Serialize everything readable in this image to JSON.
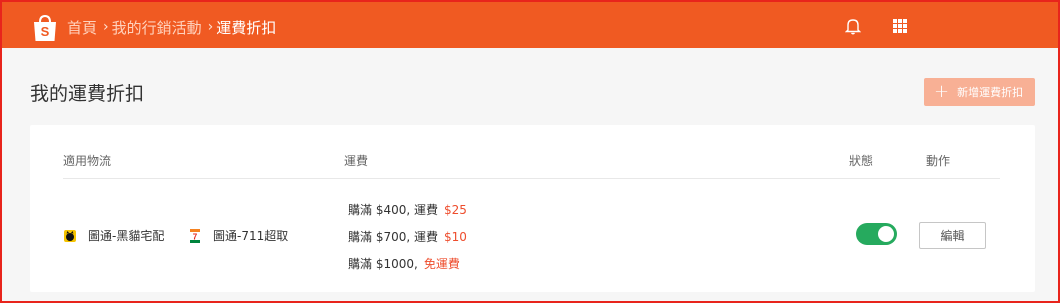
{
  "colors": {
    "brand": "#f05a22",
    "accent_text": "#ee4d2d",
    "toggle_on": "#26aa5e",
    "add_button_bg": "#f8b095",
    "frame_border": "#e8241c"
  },
  "header": {
    "logo_icon": "shopee-bag-icon",
    "breadcrumb": {
      "home": "首頁",
      "marketing": "我的行銷活動",
      "current": "運費折扣"
    },
    "icons": [
      "bell-icon",
      "apps-grid-icon"
    ]
  },
  "page": {
    "title": "我的運費折扣",
    "add_button": {
      "icon": "plus-icon",
      "label": "新增運費折扣"
    }
  },
  "table": {
    "headers": {
      "carriers": "適用物流",
      "fee": "運費",
      "status": "狀態",
      "action": "動作"
    },
    "rows": [
      {
        "carriers": [
          {
            "icon": "black-cat-logo-icon",
            "name": "圖通-黑貓宅配"
          },
          {
            "icon": "seven-eleven-logo-icon",
            "name": "圖通-711超取"
          }
        ],
        "rules": [
          {
            "condition": "購滿 $400, 運費",
            "fee": "$25"
          },
          {
            "condition": "購滿 $700, 運費",
            "fee": "$10"
          },
          {
            "condition": "購滿 $1000,",
            "fee": "免運費"
          }
        ],
        "status_on": true,
        "edit_label": "編輯"
      }
    ]
  }
}
